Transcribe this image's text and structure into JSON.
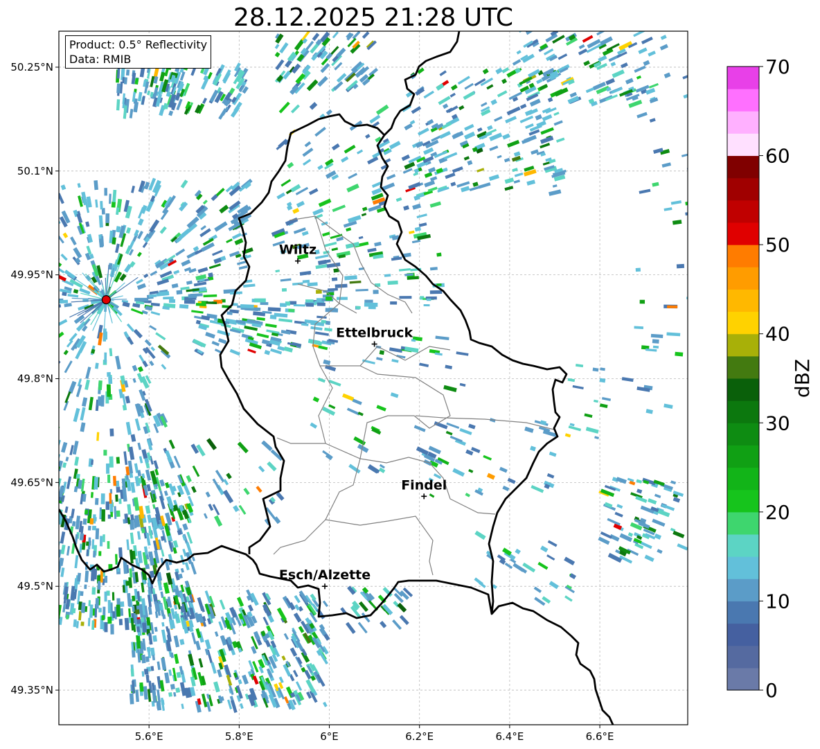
{
  "title": "28.12.2025 21:28 UTC",
  "info_box": {
    "product": "Product: 0.5° Reflectivity",
    "data": "Data: RMIB"
  },
  "map": {
    "lon_range": [
      5.4,
      6.8
    ],
    "lat_range": [
      49.3,
      50.3
    ],
    "lon_ticks": [
      "5.6°E",
      "5.8°E",
      "6°E",
      "6.2°E",
      "6.4°E",
      "6.6°E"
    ],
    "lat_ticks": [
      "50.25°N",
      "50.1°N",
      "49.95°N",
      "49.8°N",
      "49.65°N",
      "49.5°N",
      "49.35°N"
    ],
    "grid": true,
    "radar_site": {
      "lon": 5.505,
      "lat": 49.914
    },
    "cities": [
      {
        "name": "Wiltz",
        "lon": 5.93,
        "lat": 49.97
      },
      {
        "name": "Ettelbruck",
        "lon": 6.1,
        "lat": 49.85
      },
      {
        "name": "Findel",
        "lon": 6.21,
        "lat": 49.63
      },
      {
        "name": "Esch/Alzette",
        "lon": 5.99,
        "lat": 49.5
      }
    ]
  },
  "colorbar": {
    "label": "dBZ",
    "ticks": [
      "0",
      "10",
      "20",
      "30",
      "40",
      "50",
      "60",
      "70"
    ],
    "min": 0,
    "max": 70,
    "step": 2.5,
    "colors": [
      "#6a7aa8",
      "#556aa0",
      "#4560a0",
      "#4a78b0",
      "#5b9cc8",
      "#62c0da",
      "#5cd4c4",
      "#3ed66e",
      "#16c41c",
      "#12b418",
      "#10a014",
      "#0e8c12",
      "#0c780e",
      "#0a600a",
      "#437a10",
      "#a8b008",
      "#ffd200",
      "#ffb800",
      "#ff9c00",
      "#ff7c00",
      "#e00000",
      "#c00000",
      "#a00000",
      "#800000",
      "#ffe0ff",
      "#ffb0ff",
      "#ff70ff",
      "#e840e8"
    ]
  }
}
